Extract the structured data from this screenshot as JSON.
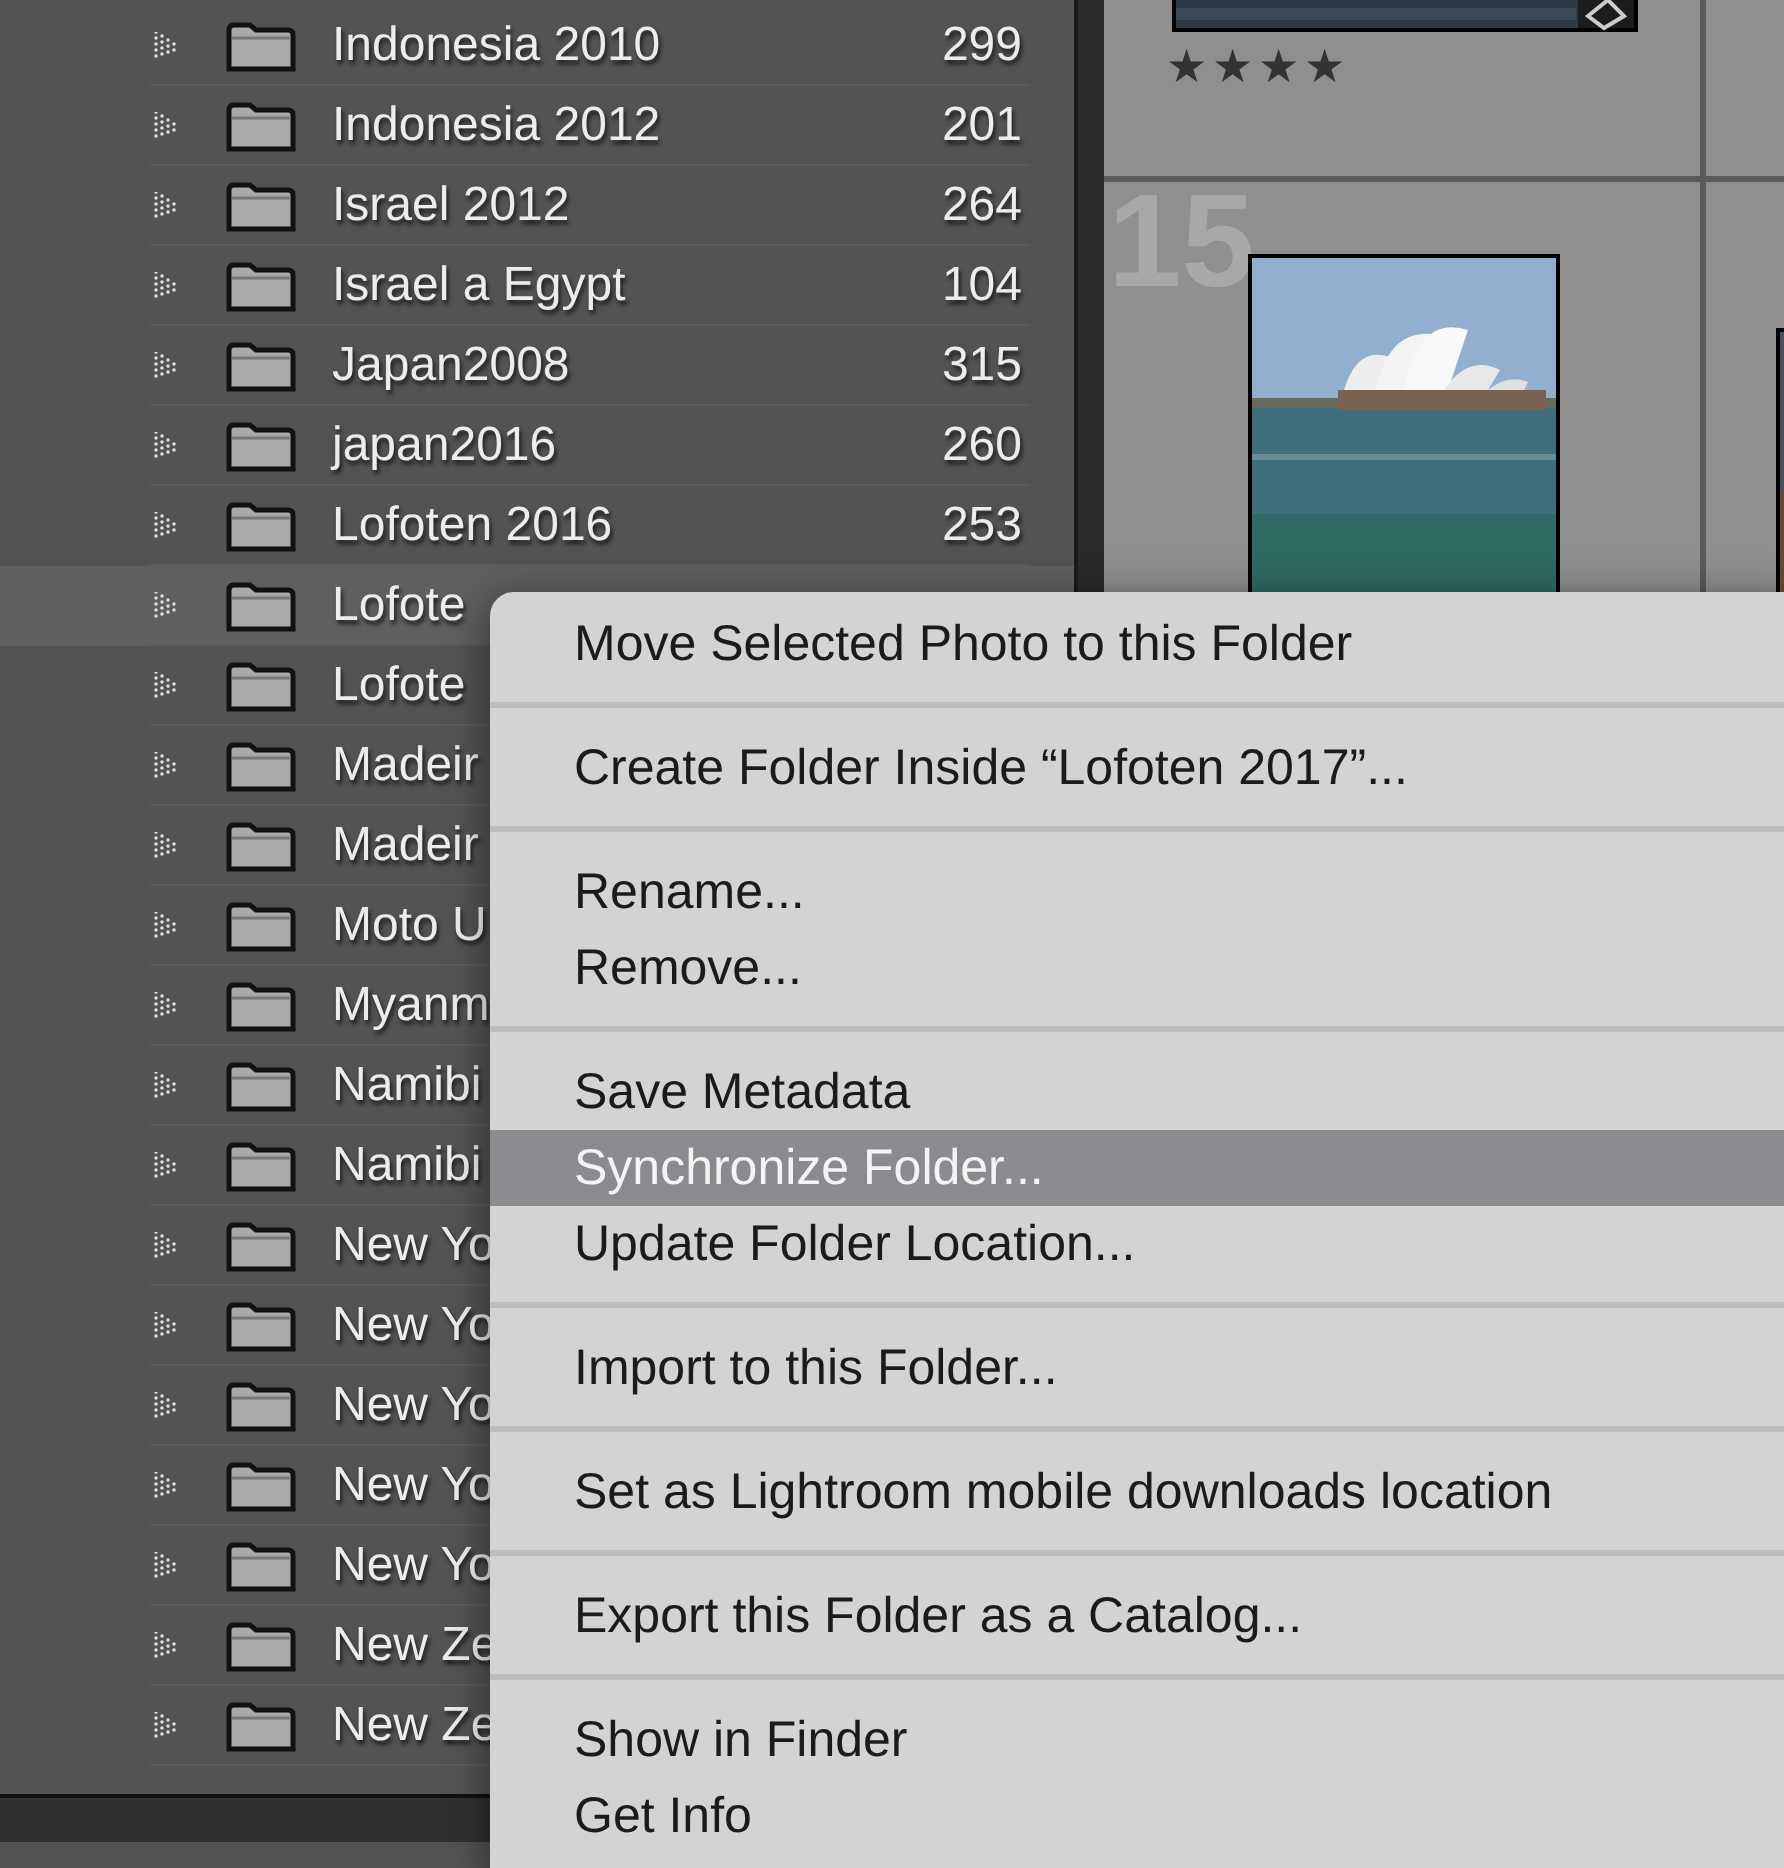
{
  "folders": [
    {
      "name": "Indonesia 2010",
      "count": "299",
      "selected": false
    },
    {
      "name": "Indonesia 2012",
      "count": "201",
      "selected": false
    },
    {
      "name": "Israel 2012",
      "count": "264",
      "selected": false
    },
    {
      "name": "Israel a Egypt",
      "count": "104",
      "selected": false
    },
    {
      "name": "Japan2008",
      "count": "315",
      "selected": false
    },
    {
      "name": "japan2016",
      "count": "260",
      "selected": false
    },
    {
      "name": "Lofoten 2016",
      "count": "253",
      "selected": false
    },
    {
      "name": "Lofote",
      "selected": true
    },
    {
      "name": "Lofote",
      "selected": false
    },
    {
      "name": "Madeir",
      "selected": false
    },
    {
      "name": "Madeir",
      "selected": false
    },
    {
      "name": "Moto U",
      "selected": false
    },
    {
      "name": "Myanm",
      "selected": false
    },
    {
      "name": "Namibi",
      "selected": false
    },
    {
      "name": "Namibi",
      "selected": false
    },
    {
      "name": "New Yo",
      "selected": false
    },
    {
      "name": "New Yo",
      "selected": false
    },
    {
      "name": "New Yo",
      "selected": false
    },
    {
      "name": "New Yo",
      "selected": false
    },
    {
      "name": "New Yo",
      "selected": false
    },
    {
      "name": "New Ze",
      "selected": false
    },
    {
      "name": "New Ze",
      "selected": false
    }
  ],
  "grid": {
    "top_cell": {
      "stars": 4
    },
    "photo_cell": {
      "number": "15"
    }
  },
  "context_menu": {
    "groups": [
      [
        {
          "label": "Move Selected Photo to this Folder",
          "selected": false
        }
      ],
      [
        {
          "label": "Create Folder Inside “Lofoten 2017”...",
          "selected": false
        }
      ],
      [
        {
          "label": "Rename...",
          "selected": false
        },
        {
          "label": "Remove...",
          "selected": false
        }
      ],
      [
        {
          "label": "Save Metadata",
          "selected": false
        },
        {
          "label": "Synchronize Folder...",
          "selected": true
        },
        {
          "label": "Update Folder Location...",
          "selected": false
        }
      ],
      [
        {
          "label": "Import to this Folder...",
          "selected": false
        }
      ],
      [
        {
          "label": "Set as Lightroom mobile downloads location",
          "selected": false
        }
      ],
      [
        {
          "label": "Export this Folder as a Catalog...",
          "selected": false
        }
      ],
      [
        {
          "label": "Show in Finder",
          "selected": false
        },
        {
          "label": "Get Info",
          "selected": false
        }
      ]
    ]
  }
}
